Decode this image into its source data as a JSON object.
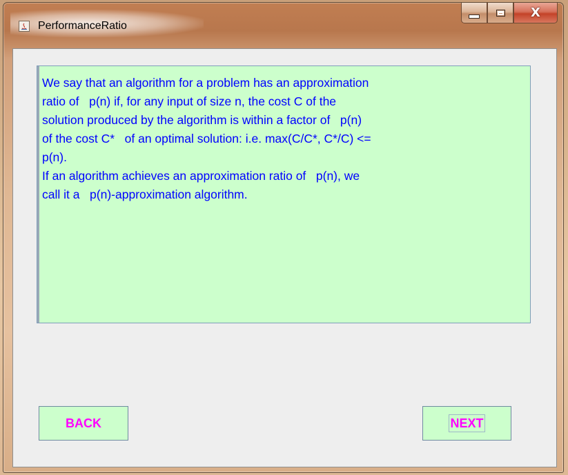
{
  "window": {
    "title": "PerformanceRatio",
    "caption_buttons": {
      "minimize_icon": "minimize-icon",
      "maximize_icon": "maximize-icon",
      "close_icon": "close-icon",
      "close_glyph": "X"
    }
  },
  "content": {
    "paragraph": "We say that an algorithm for a problem has an approximation\nratio of   p(n) if, for any input of size n, the cost C of the\nsolution produced by the algorithm is within a factor of   p(n)\nof the cost C*   of an optimal solution: i.e. max(C/C*, C*/C) <=\np(n).\nIf an algorithm achieves an approximation ratio of   p(n), we\ncall it a   p(n)-approximation algorithm."
  },
  "buttons": {
    "back_label": "BACK",
    "next_label": "NEXT"
  },
  "colors": {
    "panel_background": "#ccffcc",
    "text_color": "#0000ff",
    "button_text": "#ff00ff",
    "client_background": "#eeeeee"
  }
}
